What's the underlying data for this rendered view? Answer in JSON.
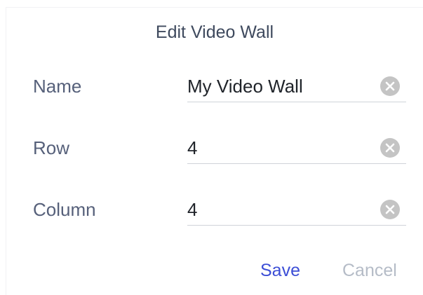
{
  "dialog": {
    "title": "Edit Video Wall",
    "fields": [
      {
        "label": "Name",
        "value": "My Video Wall"
      },
      {
        "label": "Row",
        "value": "4"
      },
      {
        "label": "Column",
        "value": "4"
      }
    ],
    "clear_icon": "clear-circle-x-icon",
    "actions": {
      "save_label": "Save",
      "cancel_label": "Cancel"
    }
  },
  "colors": {
    "title": "#3f4a5e",
    "label": "#56607a",
    "value": "#1f2329",
    "underline": "#cfd3d9",
    "clear_icon": "#c4c4c4",
    "save": "#3c4ed6",
    "cancel": "#b5bcc7"
  }
}
